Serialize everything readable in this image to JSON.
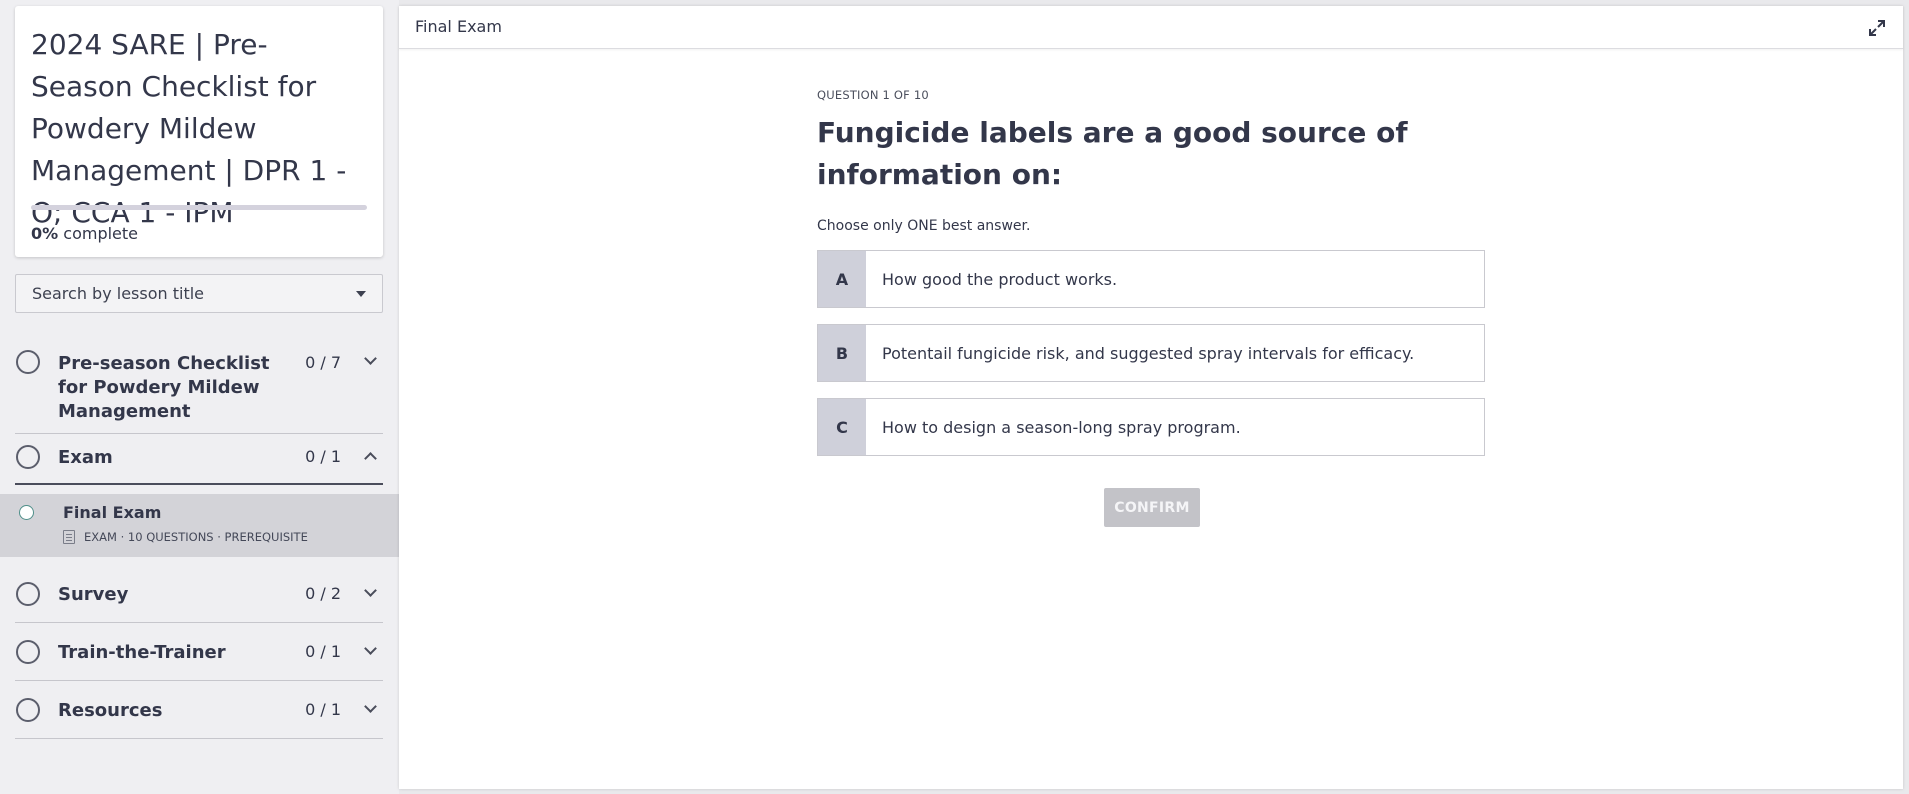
{
  "sidebar": {
    "course_title": "2024 SARE | Pre-Season Checklist for Powdery Mildew Management | DPR 1 - O; CCA 1 - IPM",
    "progress_value": "0%",
    "progress_suffix": "complete",
    "progress_fraction": 0,
    "search_placeholder": "Search by lesson title",
    "sections": [
      {
        "title": "Pre-season Checklist for Powdery Mildew Management",
        "count": "0 / 7",
        "expanded": false
      },
      {
        "title": "Exam",
        "count": "0 / 1",
        "expanded": true
      },
      {
        "title": "Survey",
        "count": "0 / 2",
        "expanded": false
      },
      {
        "title": "Train-the-Trainer",
        "count": "0 / 1",
        "expanded": false
      },
      {
        "title": "Resources",
        "count": "0 / 1",
        "expanded": false
      }
    ],
    "active_lesson": {
      "title": "Final Exam",
      "meta": "EXAM · 10 QUESTIONS · PREREQUISITE",
      "icon": "exam-icon"
    }
  },
  "main": {
    "header_title": "Final Exam",
    "expand_icon": "expand-icon",
    "question_counter": "QUESTION 1 OF 10",
    "question_text": "Fungicide labels are a good source of information on:",
    "instruction": "Choose only ONE best answer.",
    "answers": [
      {
        "letter": "A",
        "text": "How good the product works."
      },
      {
        "letter": "B",
        "text": "Potentail fungicide risk, and suggested spray intervals for efficacy."
      },
      {
        "letter": "C",
        "text": "How to design a season-long spray program."
      }
    ],
    "confirm_label": "CONFIRM"
  },
  "colors": {
    "sidebar_bg": "#efeff2",
    "active_lesson_bg": "#d3d3d8",
    "answer_letter_bg": "#cfd0da",
    "confirm_disabled_bg": "#c3c3c8",
    "text": "#33374a"
  }
}
